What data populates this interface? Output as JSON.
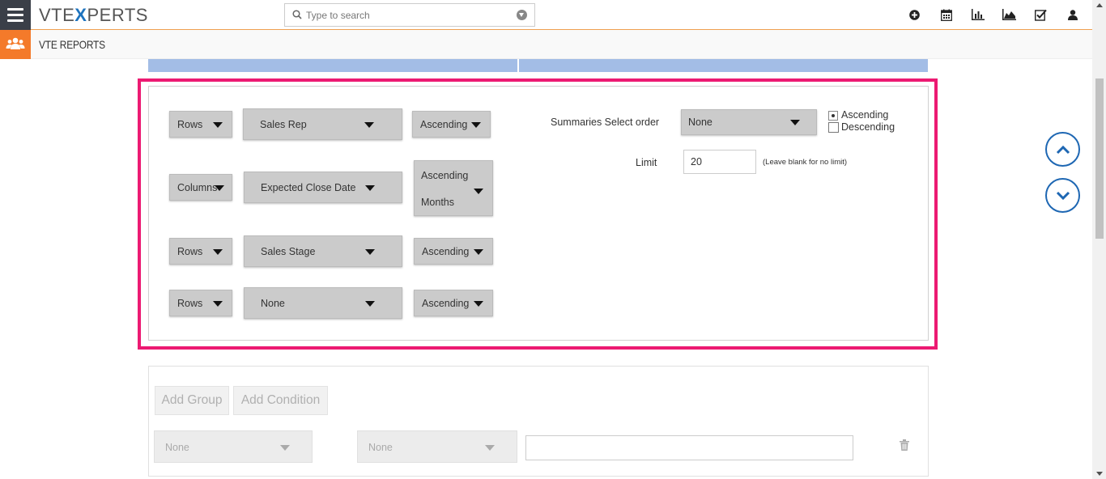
{
  "header": {
    "logo_text_a": "VTE",
    "logo_text_x": "X",
    "logo_text_b": "PERTS",
    "search_placeholder": "Type to search",
    "icons": [
      "add-icon",
      "calendar-icon",
      "reports-icon",
      "chart-area-icon",
      "tasks-checkbox-icon",
      "user-icon"
    ]
  },
  "module": {
    "title": "VTE REPORTS",
    "icon": "users-group-icon"
  },
  "sort_groups": [
    {
      "type": "Rows",
      "field": "Sales Rep",
      "order": "Ascending",
      "order_extra": ""
    },
    {
      "type": "Columns",
      "field": "Expected Close Date",
      "order": "Ascending",
      "order_extra": "Months"
    },
    {
      "type": "Rows",
      "field": "Sales Stage",
      "order": "Ascending",
      "order_extra": ""
    },
    {
      "type": "Rows",
      "field": "None",
      "order": "Ascending",
      "order_extra": ""
    }
  ],
  "summaries": {
    "label": "Summaries Select order",
    "value": "None",
    "radio_ascending": "Ascending",
    "radio_descending": "Descending",
    "selected": "Ascending"
  },
  "limit": {
    "label": "Limit",
    "value": "20",
    "note": "(Leave blank for no limit)"
  },
  "conditions": {
    "add_group": "Add Group",
    "add_condition": "Add Condition",
    "field_1": "None",
    "field_2": "None",
    "value": ""
  },
  "colors": {
    "highlight": "#ec1a72",
    "accent_orange": "#f47a2a",
    "brand_blue": "#1e67b3"
  }
}
